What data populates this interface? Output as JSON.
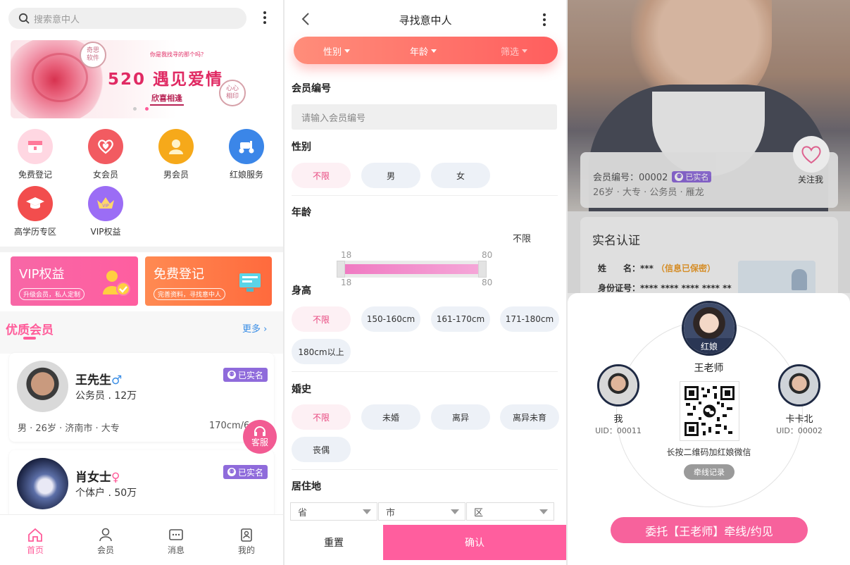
{
  "panel1": {
    "search_placeholder": "搜索意中人",
    "banner": {
      "headline": "520 遇见爱情",
      "tagline": "欣喜相逢",
      "small": "你是我找寻的那个吗？",
      "seal_left": "奇思\n软件",
      "seal_right": "心心\n相印"
    },
    "quick": [
      {
        "label": "免费登记",
        "color": "#ffd7e2",
        "icon": "register-box-icon"
      },
      {
        "label": "女会员",
        "color": "#f25b61",
        "icon": "heart-icon"
      },
      {
        "label": "男会员",
        "color": "#f6a91a",
        "icon": "user-icon"
      },
      {
        "label": "红娘服务",
        "color": "#3b86e8",
        "icon": "scooter-icon"
      },
      {
        "label": "高学历专区",
        "color": "#f24d4d",
        "icon": "graduation-cap-icon"
      },
      {
        "label": "VIP权益",
        "color": "#9b6df5",
        "icon": "vip-crown-icon"
      }
    ],
    "cards": [
      {
        "title": "VIP权益",
        "sub": "升级会员，私人定制"
      },
      {
        "title": "免费登记",
        "sub": "完善资料，寻找意中人"
      }
    ],
    "section_title": "优质会员",
    "more": "更多 ›",
    "members": [
      {
        "name": "王先生",
        "gender": "♂",
        "gender_color": "#3a8ee6",
        "job_income": "公务员 . 12万",
        "meta": "男 · 26岁 · 济南市 · 大专",
        "height": "170cm/6",
        "verified": "已实名"
      },
      {
        "name": "肖女士",
        "gender": "♀",
        "gender_color": "#ff5c9a",
        "job_income": "个体户 . 50万",
        "verified": "已实名"
      }
    ],
    "kefu": "客服",
    "tabs": [
      "首页",
      "会员",
      "消息",
      "我的"
    ]
  },
  "panel2": {
    "title": "寻找意中人",
    "filters": [
      "性别",
      "年龄",
      "筛选"
    ],
    "member_no_label": "会员编号",
    "member_no_placeholder": "请输入会员编号",
    "gender_label": "性别",
    "gender_options": [
      "不限",
      "男",
      "女"
    ],
    "age_label": "年龄",
    "age_value": "不限",
    "age_min": "18",
    "age_max": "80",
    "height_label": "身高",
    "height_options": [
      "不限",
      "150-160cm",
      "161-170cm",
      "171-180cm",
      "180cm以上"
    ],
    "marriage_label": "婚史",
    "marriage_options": [
      "不限",
      "未婚",
      "离异",
      "离异未育",
      "丧偶"
    ],
    "residence_label": "居住地",
    "residence_selects": [
      "省",
      "市",
      "区"
    ],
    "reset": "重置",
    "confirm": "确认"
  },
  "panel3": {
    "member_line": "会员编号：00002",
    "verified": "已实名",
    "member_meta": "26岁 · 大专 · 公务员 · 雁龙",
    "follow": "关注我",
    "realname_title": "实名认证",
    "name_label": "姓　　名：",
    "name_value": "***",
    "name_note": "（信息已保密）",
    "id_label": "身份证号：",
    "id_value": "**** **** **** **** **",
    "matchmaker_tag": "红娘",
    "matchmaker_name": "王老师",
    "me_name": "我",
    "me_uid": "UID：00011",
    "other_name": "卡卡北",
    "other_uid": "UID：00002",
    "qr_caption": "长按二维码加红娘微信",
    "record_btn": "牵线记录",
    "entrust_btn": "委托【王老师】牵线/约见"
  }
}
